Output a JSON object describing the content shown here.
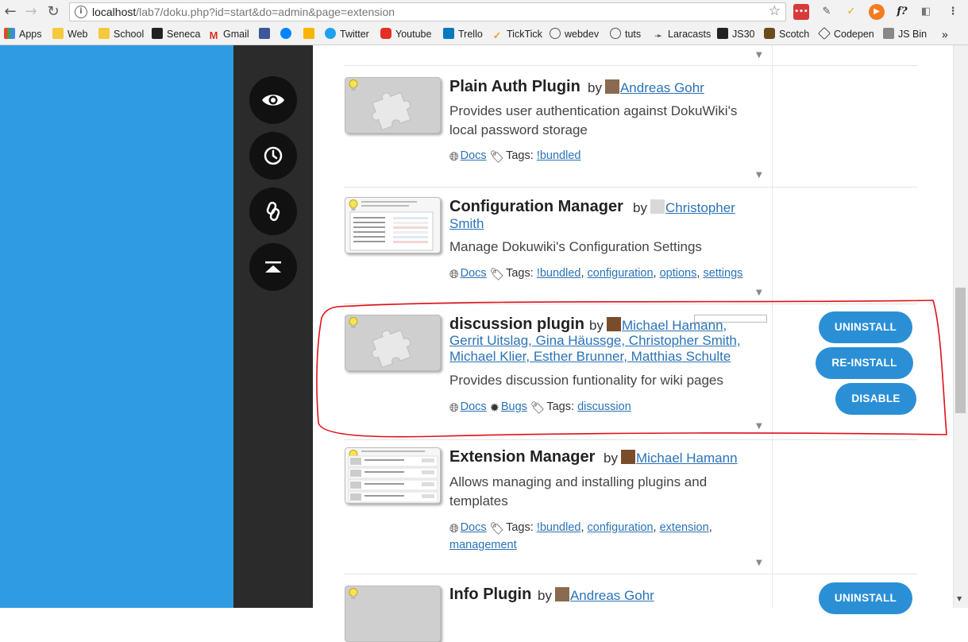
{
  "browser": {
    "url_host": "localhost",
    "url_rest": "/lab7/doku.php?id=start&do=admin&page=extension",
    "bookmarks": [
      "Apps",
      "Web",
      "School",
      "Seneca",
      "Gmail",
      "Twitter",
      "Youtube",
      "Trello",
      "TickTick",
      "webdev",
      "tuts",
      "Laracasts",
      "JS30",
      "Scotch",
      "Codepen",
      "JS Bin"
    ],
    "bookmark_overflow": "»"
  },
  "plugins": [
    {
      "title": "Plain Auth Plugin",
      "by": "by",
      "authors": "Andreas Gohr",
      "description": "Provides user authentication against DokuWiki's local password storage",
      "docs": "Docs",
      "tags_label": "Tags:",
      "tags": [
        "!bundled"
      ]
    },
    {
      "title": "Configuration Manager",
      "by": "by",
      "authors_line1": "Christopher",
      "authors_line2": "Smith",
      "description": "Manage Dokuwiki's Configuration Settings",
      "docs": "Docs",
      "tags_label": "Tags:",
      "tags": [
        "!bundled",
        "configuration",
        "options",
        "settings"
      ]
    },
    {
      "title": "discussion plugin",
      "by": "by",
      "authors_line1": "Michael Hamann,",
      "authors_line2": "Gerrit Uitslag, Gina Häussge, Christopher Smith,",
      "authors_line3": "Michael Klier, Esther Brunner, Matthias Schulte",
      "description": "Provides discussion funtionality for wiki pages",
      "docs": "Docs",
      "bugs": "Bugs",
      "tags_label": "Tags:",
      "tags": [
        "discussion"
      ],
      "buttons": {
        "uninstall": "UNINSTALL",
        "reinstall": "RE-INSTALL",
        "disable": "DISABLE"
      }
    },
    {
      "title": "Extension Manager",
      "by": "by",
      "authors": "Michael Hamann",
      "description": "Allows managing and installing plugins and templates",
      "docs": "Docs",
      "tags_label": "Tags:",
      "tags": [
        "!bundled",
        "configuration",
        "extension",
        "management"
      ]
    },
    {
      "title": "Info Plugin",
      "by": "by",
      "authors": "Andreas Gohr",
      "buttons": {
        "uninstall": "UNINSTALL"
      }
    }
  ],
  "colors": {
    "accent": "#2b8fd6",
    "sidebar": "#2f9be2",
    "toolbar": "#2b2b2b",
    "highlight_annotation": "#e0101a"
  }
}
